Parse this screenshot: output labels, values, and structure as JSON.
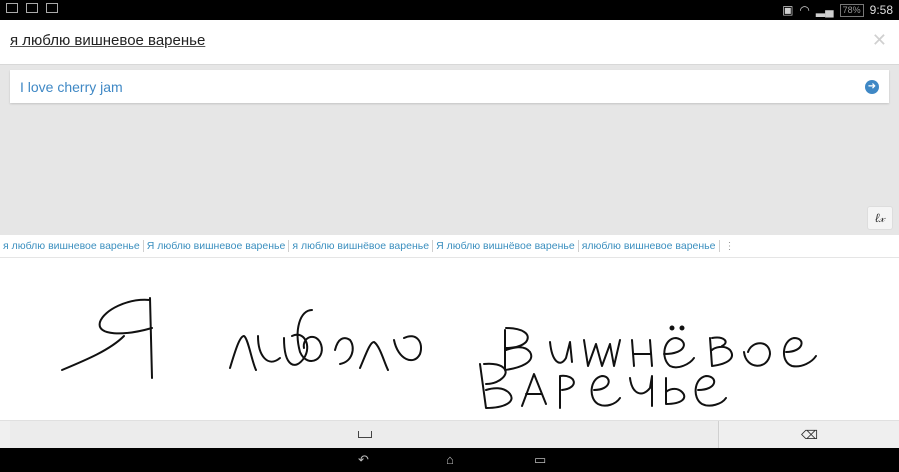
{
  "status_bar": {
    "time": "9:58",
    "battery": "78%",
    "left_icons": [
      "screen-icon",
      "grid-icon",
      "image-icon"
    ],
    "right_icons": [
      "sim-icon",
      "wifi-icon",
      "signal-icon"
    ]
  },
  "input": {
    "text": "я люблю вишневое варенье",
    "clear_icon": "close-icon"
  },
  "result": {
    "translation": "I love cherry jam",
    "go_icon": "arrow-right-circle-icon"
  },
  "handwriting_button": {
    "label": "ℓ𝓍"
  },
  "suggestions": [
    "я люблю вишневое варенье",
    "Я люблю вишневое варенье",
    "я люблю вишнёвое варенье",
    "Я люблю вишнёвое варенье",
    "ялюблю вишневое варенье"
  ],
  "suggestions_more_icon": "more-vert-icon",
  "keyboard": {
    "space_icon": "space-icon",
    "backspace_icon": "backspace-icon"
  },
  "nav_bar": {
    "icons": [
      "back-icon",
      "home-icon",
      "recents-icon"
    ]
  },
  "colors": {
    "accent": "#3f88c5",
    "suggestion_text": "#3b8fbf",
    "panel_gray": "#e6e6e6"
  }
}
